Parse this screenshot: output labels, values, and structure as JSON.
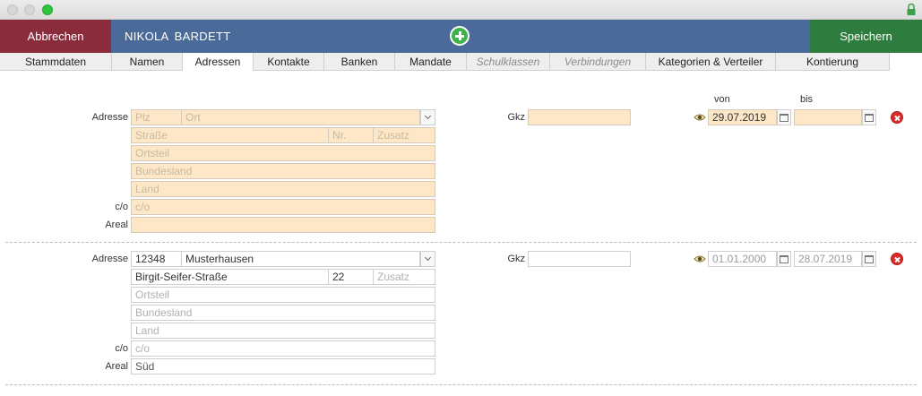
{
  "window": {
    "lock_icon": "lock-icon"
  },
  "header": {
    "cancel_label": "Abbrechen",
    "person_name": "NIKOLA  BARDETT",
    "add_icon": "plus-circle-icon",
    "save_label": "Speichern",
    "colors": {
      "cancel": "#8b2c3d",
      "bar": "#4a6b9a",
      "save": "#2e7d3e"
    }
  },
  "tabs": [
    {
      "label": "Stammdaten",
      "state": "normal"
    },
    {
      "label": "Namen",
      "state": "normal"
    },
    {
      "label": "Adressen",
      "state": "active"
    },
    {
      "label": "Kontakte",
      "state": "normal"
    },
    {
      "label": "Banken",
      "state": "normal"
    },
    {
      "label": "Mandate",
      "state": "normal"
    },
    {
      "label": "Schulklassen",
      "state": "disabled"
    },
    {
      "label": "Verbindungen",
      "state": "disabled"
    },
    {
      "label": "Kategorien & Verteiler",
      "state": "normal"
    },
    {
      "label": "Kontierung",
      "state": "normal"
    }
  ],
  "columns": {
    "von": "von",
    "bis": "bis"
  },
  "labels": {
    "adresse": "Adresse",
    "co": "c/o",
    "areal": "Areal",
    "gkz": "Gkz"
  },
  "addresses": [
    {
      "plz": {
        "value": "",
        "placeholder": "Plz"
      },
      "ort": {
        "value": "",
        "placeholder": "Ort"
      },
      "strasse": {
        "value": "",
        "placeholder": "Straße"
      },
      "nr": {
        "value": "",
        "placeholder": "Nr."
      },
      "zusatz": {
        "value": "",
        "placeholder": "Zusatz"
      },
      "ortsteil": {
        "value": "",
        "placeholder": "Ortsteil"
      },
      "bundesland": {
        "value": "",
        "placeholder": "Bundesland"
      },
      "land": {
        "value": "",
        "placeholder": "Land"
      },
      "co": {
        "value": "",
        "placeholder": "c/o"
      },
      "areal": {
        "value": "",
        "placeholder": ""
      },
      "gkz": {
        "value": ""
      },
      "von": "29.07.2019",
      "bis": "",
      "highlighted": true
    },
    {
      "plz": {
        "value": "12348",
        "placeholder": "Plz"
      },
      "ort": {
        "value": "Musterhausen",
        "placeholder": "Ort"
      },
      "strasse": {
        "value": "Birgit-Seifer-Straße",
        "placeholder": "Straße"
      },
      "nr": {
        "value": "22",
        "placeholder": "Nr."
      },
      "zusatz": {
        "value": "",
        "placeholder": "Zusatz"
      },
      "ortsteil": {
        "value": "",
        "placeholder": "Ortsteil"
      },
      "bundesland": {
        "value": "",
        "placeholder": "Bundesland"
      },
      "land": {
        "value": "",
        "placeholder": "Land"
      },
      "co": {
        "value": "",
        "placeholder": "c/o"
      },
      "areal": {
        "value": "Süd",
        "placeholder": ""
      },
      "gkz": {
        "value": ""
      },
      "von": "01.01.2000",
      "bis": "28.07.2019",
      "highlighted": false
    }
  ]
}
